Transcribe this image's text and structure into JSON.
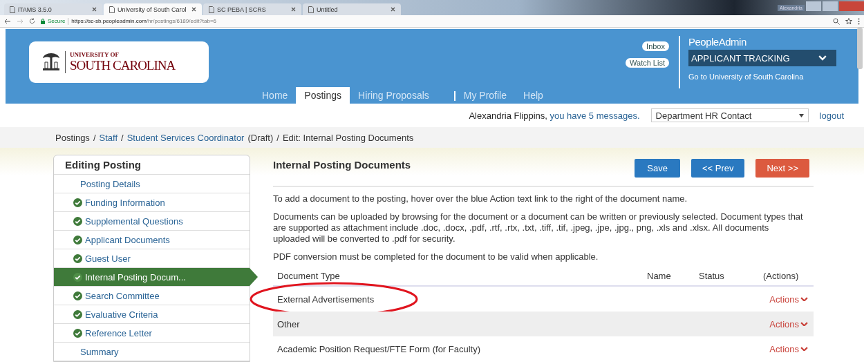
{
  "browser": {
    "tabs": [
      {
        "title": "iTAMS 3.5.0",
        "selected": false
      },
      {
        "title": "University of South Carol",
        "selected": true
      },
      {
        "title": "SC PEBA | SCRS",
        "selected": false
      },
      {
        "title": "Untitled",
        "selected": false
      }
    ],
    "window_user": "Alexandria",
    "url": {
      "secure_label": "Secure",
      "host": "https://sc-sb.peopleadmin.com",
      "path": "/hr/postings/6189/edit?tab=6"
    }
  },
  "header": {
    "logo": {
      "line1": "UNIVERSITY OF",
      "line2": "SOUTH CAROLINA"
    },
    "links": [
      "Inbox",
      "Watch List"
    ],
    "brand": "PeopleAdmin",
    "product": "APPLICANT TRACKING",
    "org_link": "Go to University of South Carolina",
    "nav": [
      {
        "kind": "tab",
        "label": "Home",
        "selected": false
      },
      {
        "kind": "tab",
        "label": "Postings",
        "selected": true
      },
      {
        "kind": "tab",
        "label": "Hiring Proposals",
        "selected": false
      },
      {
        "kind": "separator"
      },
      {
        "kind": "tab",
        "label": "My Profile",
        "selected": false
      },
      {
        "kind": "tab",
        "label": "Help",
        "selected": false
      }
    ]
  },
  "userbar": {
    "name": "Alexandria Flippins,",
    "messages": "you have 5 messages.",
    "role": "Department HR Contact",
    "logout": "logout"
  },
  "breadcrumb": [
    {
      "kind": "text",
      "label": "Postings"
    },
    {
      "kind": "sep",
      "label": "/"
    },
    {
      "kind": "link",
      "label": "Staff"
    },
    {
      "kind": "sep",
      "label": "/"
    },
    {
      "kind": "link",
      "label": "Student Services Coordinator"
    },
    {
      "kind": "text",
      "label": "(Draft)"
    },
    {
      "kind": "sep",
      "label": "/"
    },
    {
      "kind": "text",
      "label": "Edit: Internal Posting Documents"
    }
  ],
  "sidebar": {
    "title": "Editing Posting",
    "items": [
      {
        "label": "Posting Details",
        "complete": false,
        "selected": false
      },
      {
        "label": "Funding Information",
        "complete": true,
        "selected": false
      },
      {
        "label": "Supplemental Questions",
        "complete": true,
        "selected": false
      },
      {
        "label": "Applicant Documents",
        "complete": true,
        "selected": false
      },
      {
        "label": "Guest User",
        "complete": true,
        "selected": false
      },
      {
        "label": "Internal Posting Docum...",
        "complete": true,
        "selected": true
      },
      {
        "label": "Search Committee",
        "complete": true,
        "selected": false
      },
      {
        "label": "Evaluative Criteria",
        "complete": true,
        "selected": false
      },
      {
        "label": "Reference Letter",
        "complete": true,
        "selected": false
      },
      {
        "label": "Summary",
        "complete": false,
        "selected": false
      }
    ]
  },
  "main": {
    "title": "Internal Posting Documents",
    "buttons": [
      {
        "kind": "save",
        "label": "Save"
      },
      {
        "kind": "prev",
        "label": "<< Prev"
      },
      {
        "kind": "next",
        "label": "Next >>"
      }
    ],
    "paragraphs": [
      "To add a document to the posting, hover over the blue Action text link to the right of the document name.",
      "Documents can be uploaded by browsing for the document or a document can be written or previously selected. Document types that are supported as attachment include .doc, .docx, .pdf, .rtf, .rtx, .txt, .tiff, .tif, .jpeg, .jpe, .jpg., png, .xls and .xlsx. All documents uploaded will be converted to .pdf for security.",
      "PDF conversion must be completed for the document to be valid when applicable."
    ],
    "table": {
      "columns": [
        "Document Type",
        "Name",
        "Status",
        "(Actions)"
      ],
      "rows": [
        {
          "document_type": "External Advertisements",
          "actions": "Actions",
          "circled": true
        },
        {
          "document_type": "Other",
          "actions": "Actions",
          "circled": false
        },
        {
          "document_type": "Academic Position Request/FTE Form (for Faculty)",
          "actions": "Actions",
          "circled": false
        }
      ]
    }
  }
}
